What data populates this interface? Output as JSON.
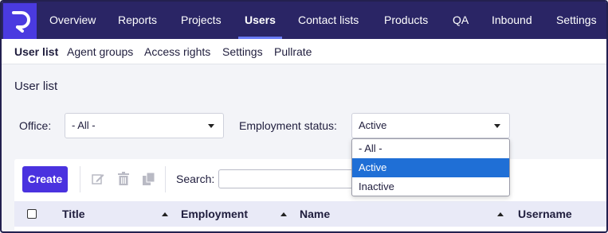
{
  "topnav": {
    "items": [
      "Overview",
      "Reports",
      "Projects",
      "Users",
      "Contact lists",
      "Products",
      "QA",
      "Inbound",
      "Settings"
    ],
    "active": "Users"
  },
  "subnav": {
    "items": [
      "User list",
      "Agent groups",
      "Access rights",
      "Settings",
      "Pullrate"
    ],
    "active": "User list"
  },
  "page": {
    "title": "User list"
  },
  "filters": {
    "office_label": "Office:",
    "office_value": "- All -",
    "employment_label": "Employment status:",
    "employment_value": "Active",
    "employment_options": [
      "- All -",
      "Active",
      "Inactive"
    ]
  },
  "toolbar": {
    "create_label": "Create",
    "search_label": "Search:",
    "search_value": ""
  },
  "table": {
    "columns": [
      "Title",
      "Employment",
      "Name",
      "Username"
    ]
  },
  "colors": {
    "nav_bg": "#2a2565",
    "accent": "#4a32df",
    "selected_option": "#1f6fd6"
  },
  "icons": [
    "logo-icon",
    "edit-icon",
    "trash-icon",
    "copy-icon",
    "chevron-down-icon",
    "sort-asc-icon"
  ]
}
